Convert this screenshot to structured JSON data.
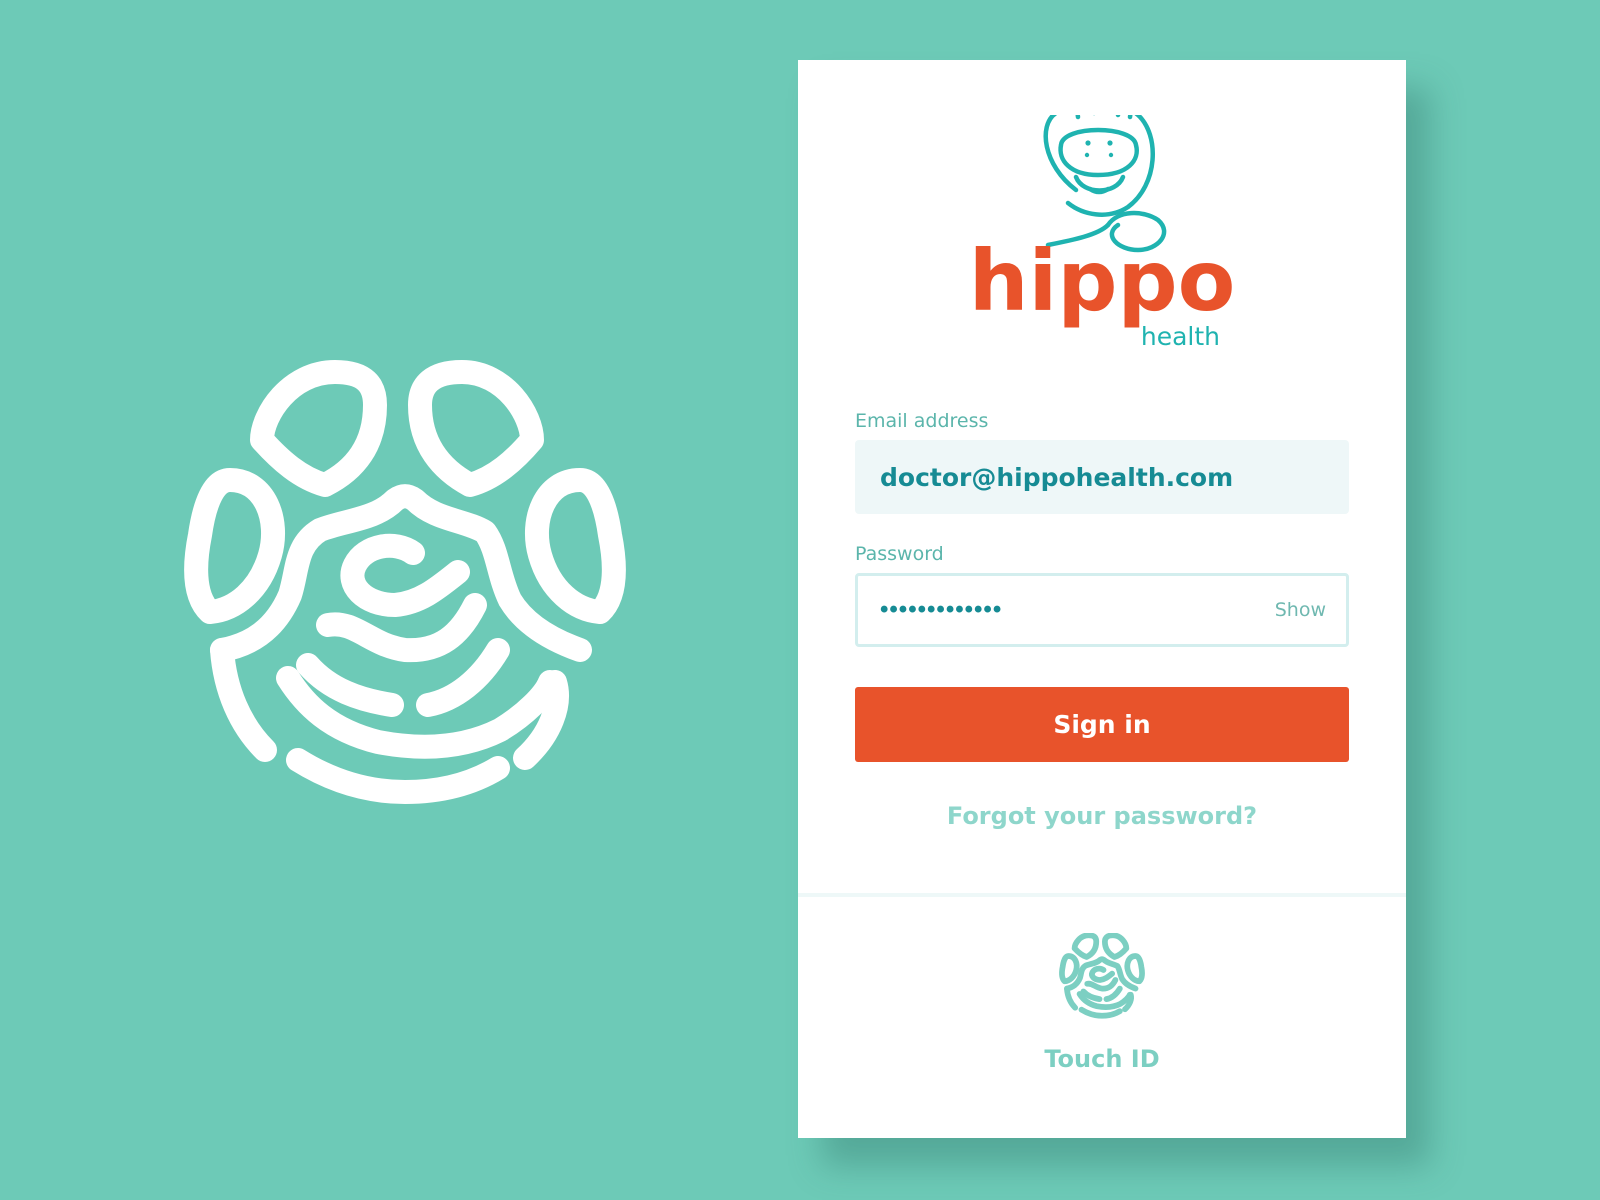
{
  "brand": {
    "name": "hippo",
    "sub": "health",
    "primary_color": "#e8532b",
    "accent_color": "#1fb3b0",
    "background_color": "#6dcab7"
  },
  "form": {
    "email_label": "Email address",
    "email_value": "doctor@hippohealth.com",
    "password_label": "Password",
    "password_masked": "•••••••••••••",
    "show_label": "Show",
    "signin_label": "Sign in",
    "forgot_label": "Forgot your password?"
  },
  "touch": {
    "label": "Touch ID",
    "icon": "fingerprint-icon"
  },
  "decor": {
    "icon": "fingerprint-icon"
  }
}
